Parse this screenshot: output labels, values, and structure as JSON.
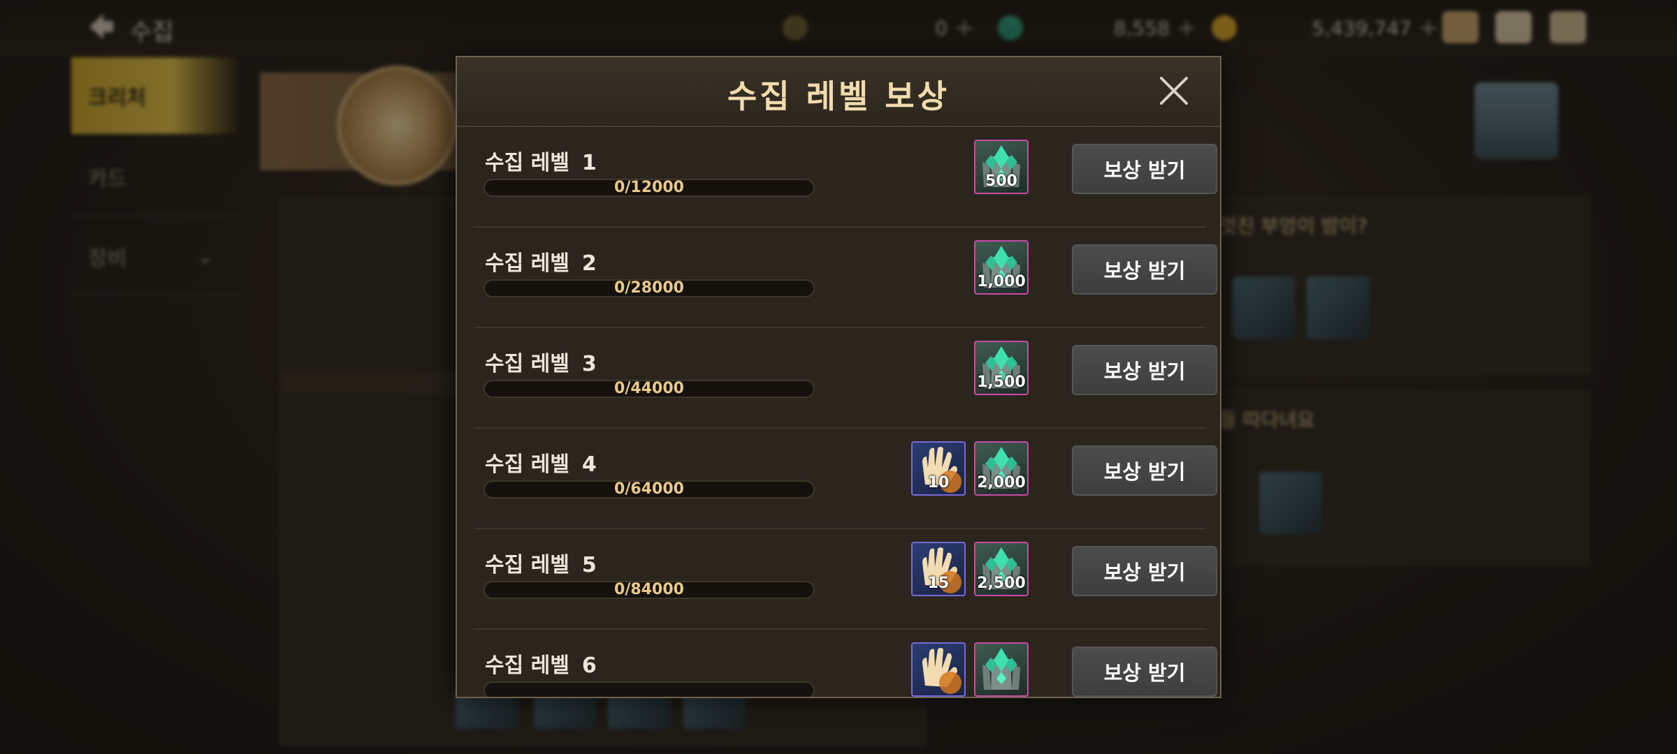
{
  "topbar": {
    "title": "수집",
    "currencies": [
      {
        "icon": "crescent-coin-icon",
        "value": "0",
        "color": "#7a6a3c"
      },
      {
        "icon": "green-crystal-icon",
        "value": "8,558",
        "color": "#3fae8a"
      },
      {
        "icon": "gold-coin-icon",
        "value": "5,439,747",
        "color": "#d9a72a"
      }
    ],
    "icons": [
      "bag-icon",
      "mail-icon",
      "chat-icon"
    ]
  },
  "sidebar": {
    "items": [
      {
        "label": "크리처",
        "active": true
      },
      {
        "label": "카드",
        "active": false
      },
      {
        "label": "장비",
        "active": false
      }
    ]
  },
  "background_panels": {
    "panel1_title": "멋진 부엉이 밤이?",
    "panel2_title": "들 따다녀요"
  },
  "modal": {
    "title": "수집 레벨 보상",
    "row_label_prefix": "수집 레벨",
    "claim_label": "보상 받기",
    "rows": [
      {
        "level": "1",
        "progress": "0/12000",
        "progress_fraction": 0,
        "rewards": [
          {
            "type": "crystal",
            "qty": "500"
          }
        ]
      },
      {
        "level": "2",
        "progress": "0/28000",
        "progress_fraction": 0,
        "rewards": [
          {
            "type": "crystal",
            "qty": "1,000"
          }
        ]
      },
      {
        "level": "3",
        "progress": "0/44000",
        "progress_fraction": 0,
        "rewards": [
          {
            "type": "crystal",
            "qty": "1,500"
          }
        ]
      },
      {
        "level": "4",
        "progress": "0/64000",
        "progress_fraction": 0,
        "rewards": [
          {
            "type": "glove",
            "qty": "10"
          },
          {
            "type": "crystal",
            "qty": "2,000"
          }
        ]
      },
      {
        "level": "5",
        "progress": "0/84000",
        "progress_fraction": 0,
        "rewards": [
          {
            "type": "glove",
            "qty": "15"
          },
          {
            "type": "crystal",
            "qty": "2,500"
          }
        ]
      },
      {
        "level": "6",
        "progress": "",
        "progress_fraction": 0,
        "rewards": [
          {
            "type": "glove",
            "qty": ""
          },
          {
            "type": "crystal",
            "qty": ""
          }
        ]
      }
    ]
  }
}
